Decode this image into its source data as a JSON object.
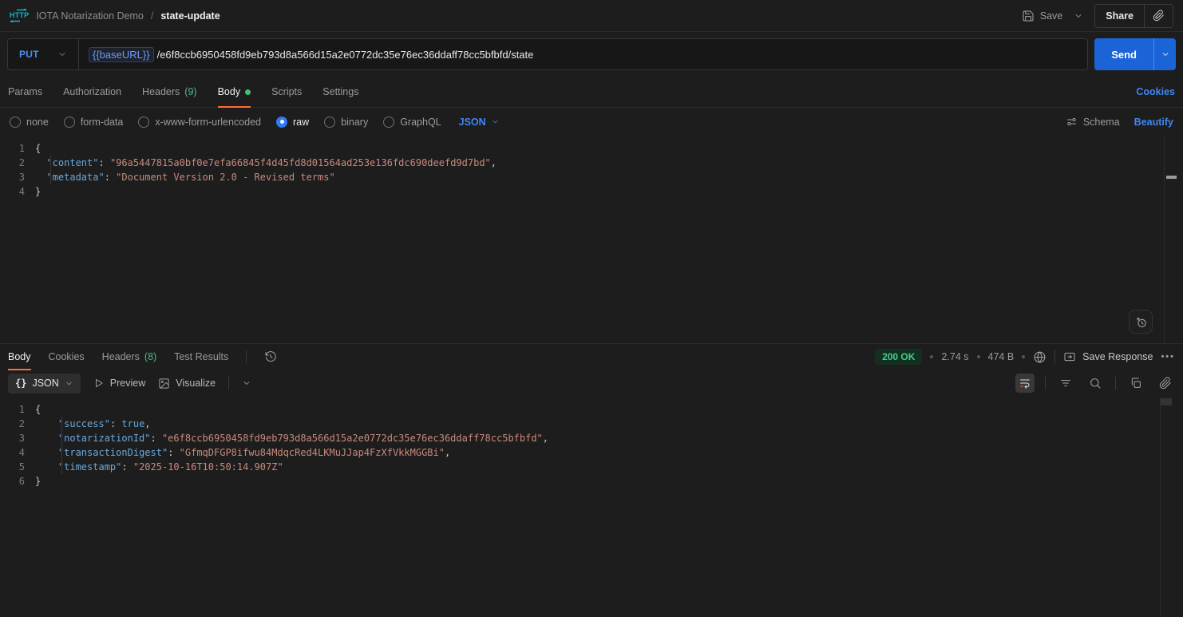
{
  "colors": {
    "accent_orange": "#ff6c37",
    "link_blue": "#4086f4",
    "method_blue": "#4a8df6",
    "send_button_blue": "#1a64d8",
    "success_green": "#49cc90",
    "http_icon_teal": "#18b3c7"
  },
  "icons": {
    "more_options": "•••",
    "json_braces": "{}"
  },
  "topbar": {
    "collection_name": "IOTA Notarization Demo",
    "separator": "/",
    "request_name": "state-update",
    "save_label": "Save",
    "share_label": "Share"
  },
  "request_bar": {
    "method": "PUT",
    "url_variable": "{{baseURL}}",
    "url_path": "/e6f8ccb6950458fd9eb793d8a566d15a2e0772dc35e76ec36ddaff78cc5bfbfd/state",
    "send_label": "Send"
  },
  "request_tabs": {
    "params": "Params",
    "authorization": "Authorization",
    "headers": "Headers",
    "headers_count": "(9)",
    "body": "Body",
    "scripts": "Scripts",
    "settings": "Settings",
    "cookies_link": "Cookies"
  },
  "body_options": {
    "none": "none",
    "form_data": "form-data",
    "urlencoded": "x-www-form-urlencoded",
    "raw": "raw",
    "binary": "binary",
    "graphql": "GraphQL",
    "language": "JSON",
    "schema": "Schema",
    "beautify": "Beautify"
  },
  "request_body": {
    "lines": [
      [
        {
          "t": "punc",
          "v": "{"
        }
      ],
      [
        {
          "t": "plain",
          "v": "  "
        },
        {
          "t": "key",
          "v": "\"content\""
        },
        {
          "t": "punc",
          "v": ": "
        },
        {
          "t": "str",
          "v": "\"96a5447815a0bf0e7efa66845f4d45fd8d01564ad253e136fdc690deefd9d7bd\""
        },
        {
          "t": "punc",
          "v": ","
        }
      ],
      [
        {
          "t": "plain",
          "v": "  "
        },
        {
          "t": "key",
          "v": "\"metadata\""
        },
        {
          "t": "punc",
          "v": ": "
        },
        {
          "t": "str",
          "v": "\"Document Version 2.0 - Revised terms\""
        }
      ],
      [
        {
          "t": "punc",
          "v": "}"
        }
      ]
    ]
  },
  "response": {
    "tabs": {
      "body": "Body",
      "cookies": "Cookies",
      "headers": "Headers",
      "headers_count": "(8)",
      "test_results": "Test Results"
    },
    "status": {
      "code": "200 OK",
      "time": "2.74 s",
      "size": "474 B"
    },
    "save_response_label": "Save Response",
    "toolbar": {
      "format_label": "JSON",
      "preview": "Preview",
      "visualize": "Visualize"
    },
    "body_lines": [
      [
        {
          "t": "punc",
          "v": "{"
        }
      ],
      [
        {
          "t": "plain",
          "v": "    "
        },
        {
          "t": "key",
          "v": "\"success\""
        },
        {
          "t": "punc",
          "v": ": "
        },
        {
          "t": "bool",
          "v": "true"
        },
        {
          "t": "punc",
          "v": ","
        }
      ],
      [
        {
          "t": "plain",
          "v": "    "
        },
        {
          "t": "key",
          "v": "\"notarizationId\""
        },
        {
          "t": "punc",
          "v": ": "
        },
        {
          "t": "str",
          "v": "\"e6f8ccb6950458fd9eb793d8a566d15a2e0772dc35e76ec36ddaff78cc5bfbfd\""
        },
        {
          "t": "punc",
          "v": ","
        }
      ],
      [
        {
          "t": "plain",
          "v": "    "
        },
        {
          "t": "key",
          "v": "\"transactionDigest\""
        },
        {
          "t": "punc",
          "v": ": "
        },
        {
          "t": "str",
          "v": "\"GfmqDFGP8ifwu84MdqcRed4LKMuJJap4FzXfVkkMGGBi\""
        },
        {
          "t": "punc",
          "v": ","
        }
      ],
      [
        {
          "t": "plain",
          "v": "    "
        },
        {
          "t": "key",
          "v": "\"timestamp\""
        },
        {
          "t": "punc",
          "v": ": "
        },
        {
          "t": "str",
          "v": "\"2025-10-16T10:50:14.907Z\""
        }
      ],
      [
        {
          "t": "punc",
          "v": "}"
        }
      ]
    ]
  }
}
